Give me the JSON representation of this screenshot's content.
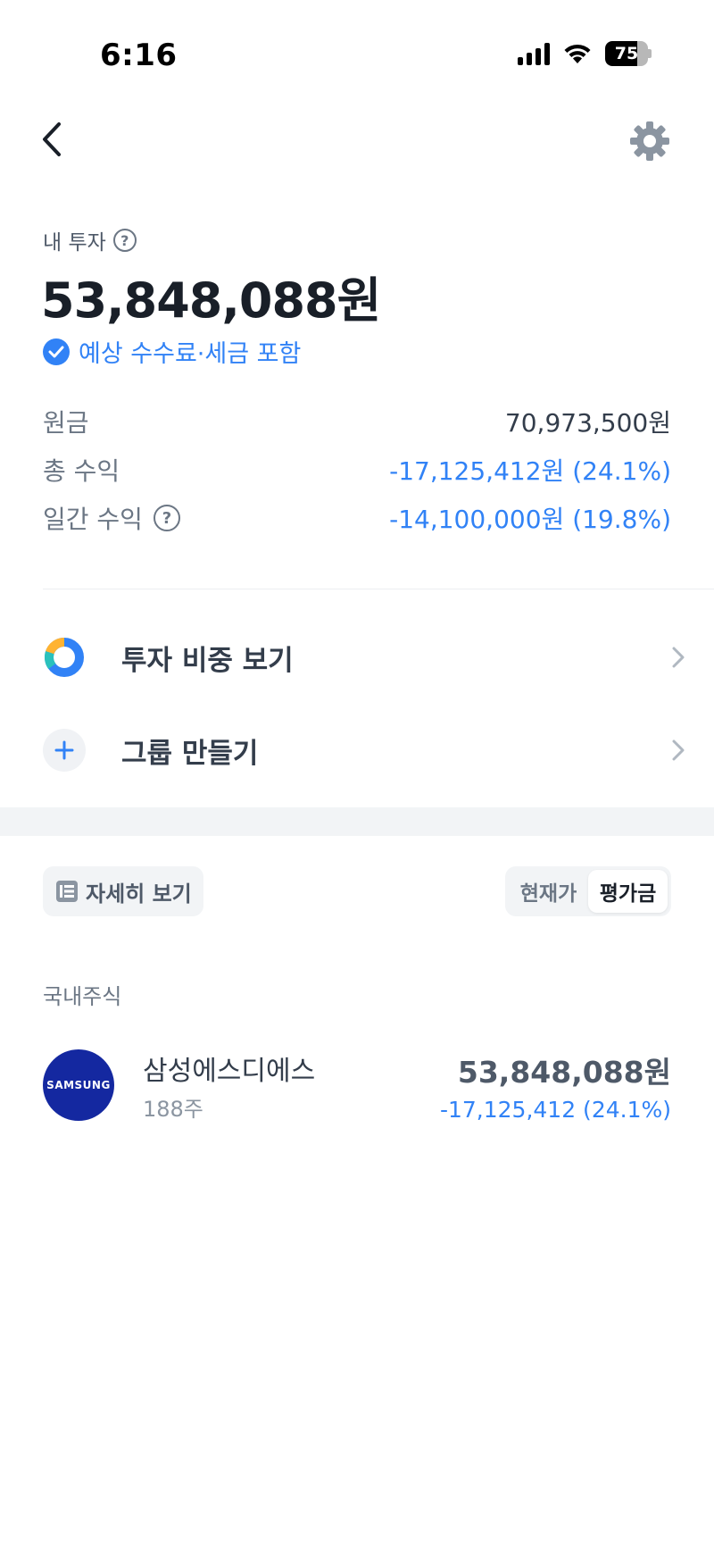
{
  "status_bar": {
    "time": "6:16",
    "battery": "75",
    "battery_level": 0.75
  },
  "summary": {
    "label": "내 투자",
    "total": "53,848,088원",
    "fee_note": "예상 수수료·세금 포함",
    "rows": [
      {
        "label": "원금",
        "value": "70,973,500원"
      },
      {
        "label": "총 수익",
        "value": "-17,125,412원 (24.1%)"
      },
      {
        "label": "일간 수익",
        "value": "-14,100,000원 (19.8%)"
      }
    ]
  },
  "menu": {
    "items": [
      {
        "label": "투자 비중 보기",
        "icon": "donut-chart-icon"
      },
      {
        "label": "그룹 만들기",
        "icon": "plus-icon"
      }
    ]
  },
  "controls": {
    "detail_label": "자세히 보기",
    "toggle": [
      "현재가",
      "평가금"
    ],
    "toggle_selected": "평가금"
  },
  "holdings": {
    "section_label": "국내주식",
    "items": [
      {
        "logo_text": "SAMSUNG",
        "name": "삼성에스디에스",
        "qty": "188주",
        "value": "53,848,088원",
        "change": "-17,125,412 (24.1%)"
      }
    ]
  },
  "colors": {
    "accent_blue": "#3182f6",
    "samsung_blue": "#1428a0"
  }
}
